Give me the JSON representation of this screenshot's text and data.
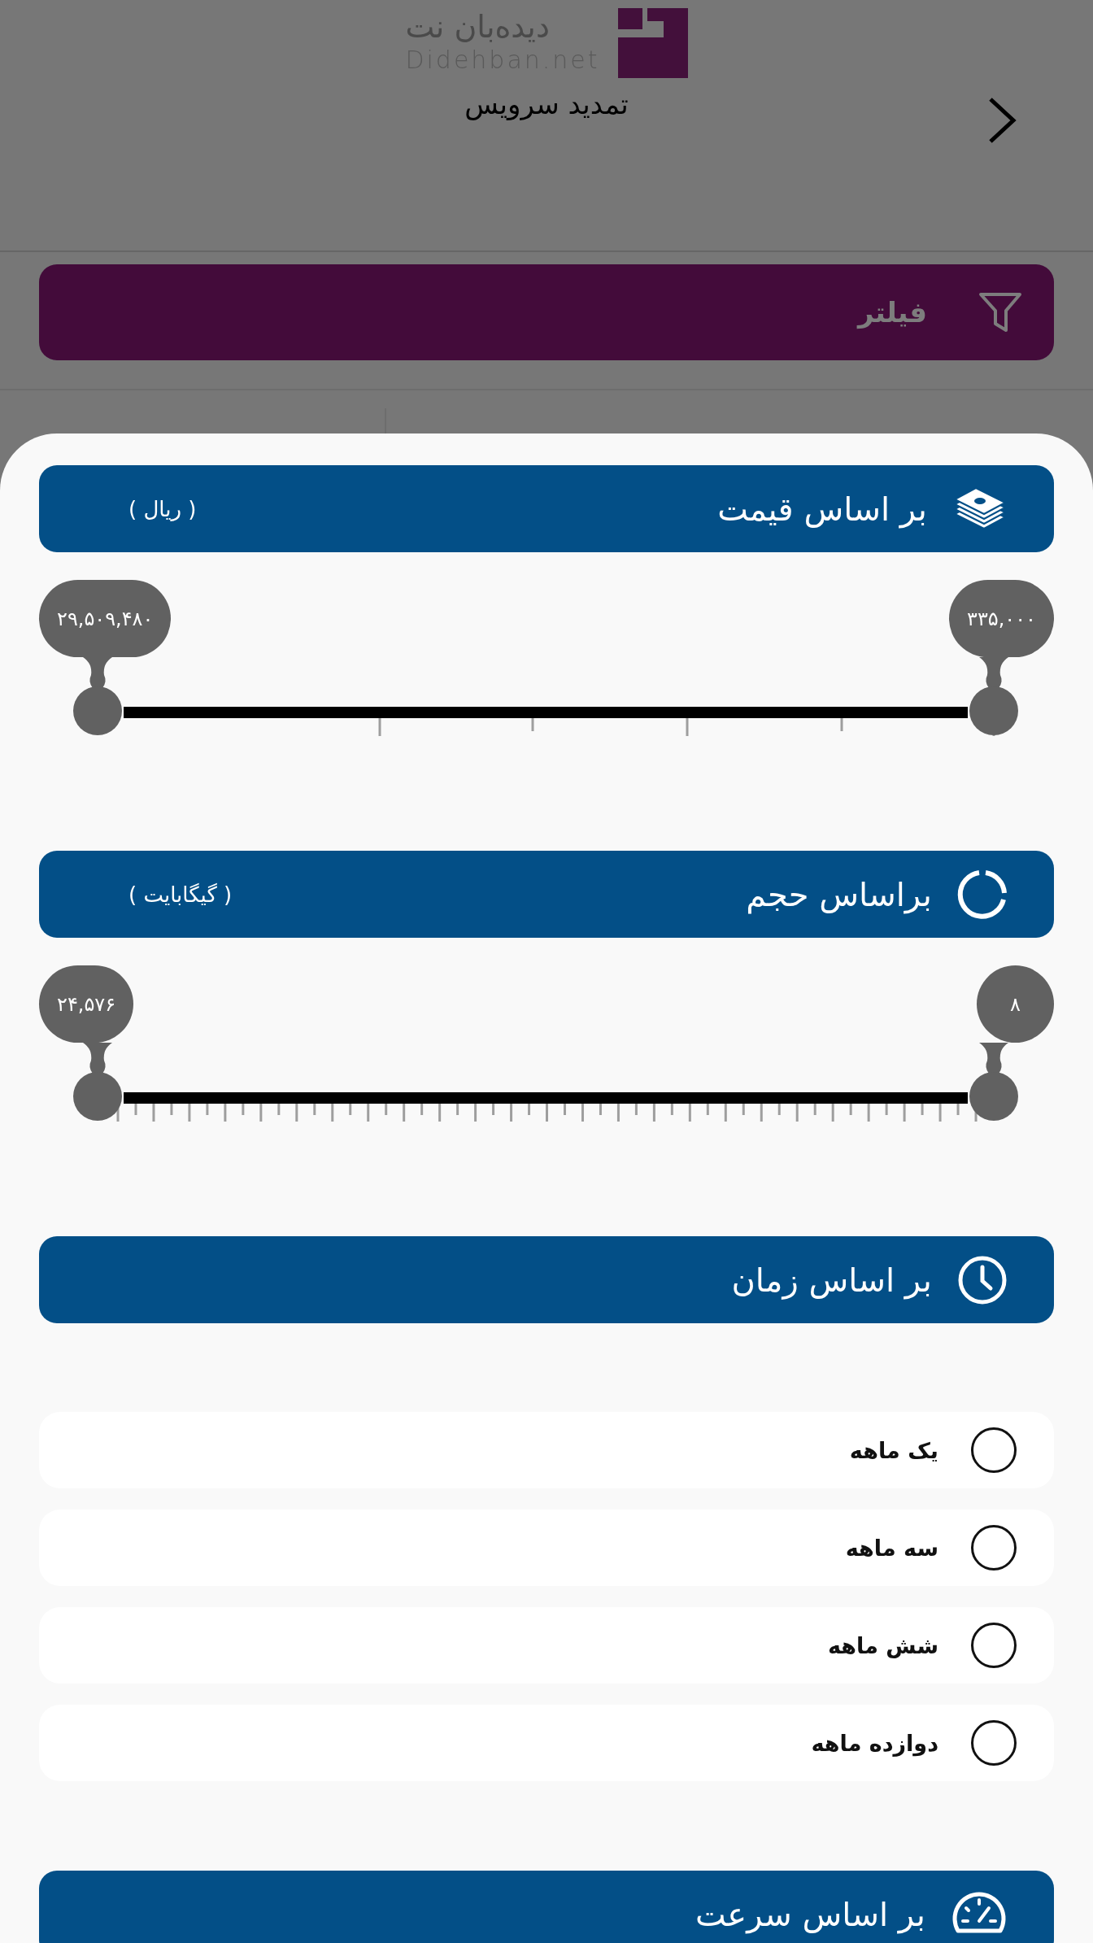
{
  "header": {
    "logo_text": "دیده‌بان نت",
    "logo_latin": "Didehban.net",
    "title": "تمدید سرویس"
  },
  "filter_bar": {
    "label": "فیلتر"
  },
  "sections": [
    {
      "kind": "slider",
      "title": "بر اساس قیمت",
      "unit": "( ریال )",
      "thumbs": [
        {
          "label": "۳۳۵,۰۰۰",
          "level": 1
        },
        {
          "label": "۲۹,۵۰۹,۴۸۰",
          "level": 0
        }
      ]
    },
    {
      "kind": "slider",
      "title": "براساس حجم",
      "unit": "( گیگابایت )",
      "thumbs": [
        {
          "label": "۸",
          "level": 1
        },
        {
          "label": "۲۴,۵۷۶",
          "level": 0
        }
      ]
    },
    {
      "kind": "options",
      "title": "بر اساس زمان",
      "options": [
        {
          "label": "یک ماهه",
          "selected": false
        },
        {
          "label": "سه ماهه",
          "selected": false
        },
        {
          "label": "شش ماهه",
          "selected": false
        },
        {
          "label": "دوازده ماهه",
          "selected": false
        }
      ]
    },
    {
      "kind": "heading",
      "title": "بر اساس سرعت"
    }
  ]
}
